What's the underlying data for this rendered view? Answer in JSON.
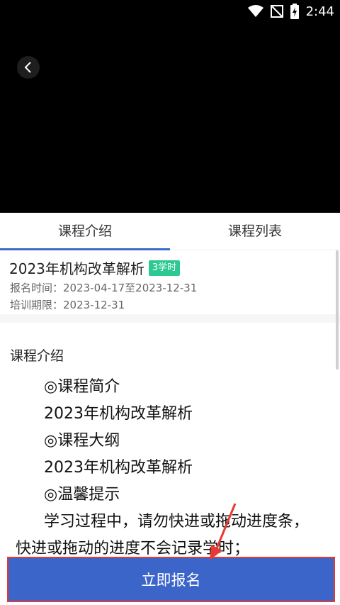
{
  "status_bar": {
    "time": "2:44"
  },
  "tabs": [
    {
      "label": "课程介绍",
      "active": true
    },
    {
      "label": "课程列表",
      "active": false
    }
  ],
  "course": {
    "title": "2023年机构改革解析",
    "badge": "3学时",
    "signup_time": "报名时间：2023-04-17至2023-12-31",
    "training_deadline": "培训期限：2023-12-31"
  },
  "intro": {
    "heading": "课程介绍",
    "lines": [
      "◎课程简介",
      "2023年机构改革解析",
      "◎课程大纲",
      "2023年机构改革解析",
      "◎温馨提示",
      "学习过程中，请勿快进或拖动进度条，快进或拖动的进度不会记录学时；"
    ]
  },
  "enroll_button": "立即报名",
  "colors": {
    "accent": "#3b65c9",
    "badge": "#2cc991",
    "highlight": "#e53935"
  }
}
